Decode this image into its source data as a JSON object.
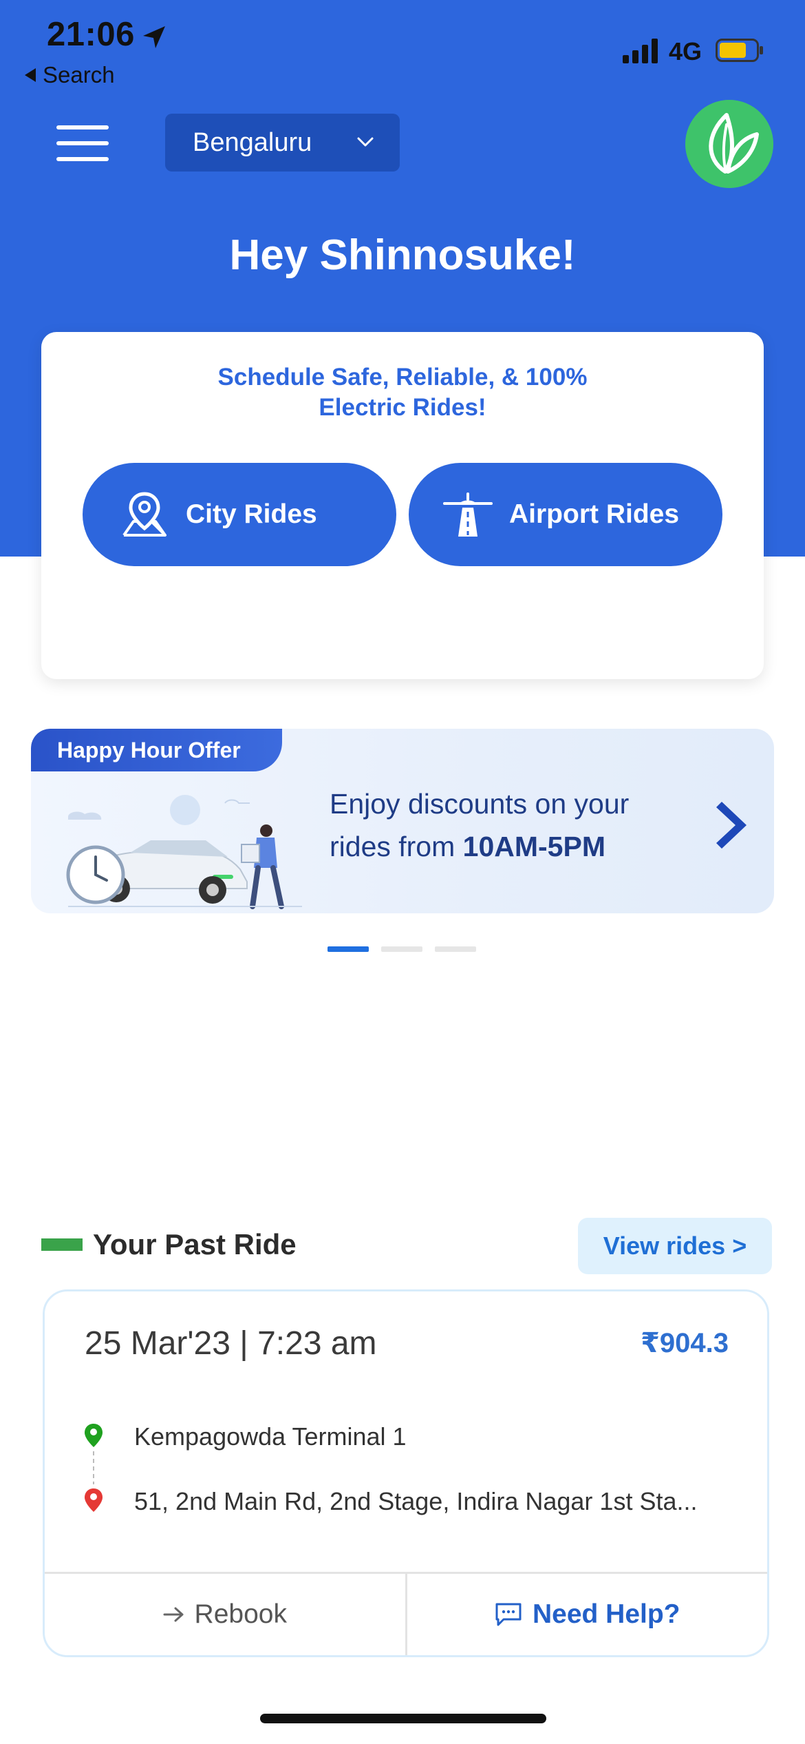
{
  "status_bar": {
    "time": "21:06",
    "back_label": "Search",
    "network": "4G",
    "battery_color": "#f5c400"
  },
  "header": {
    "city": "Bengaluru"
  },
  "greeting": "Hey Shinnosuke!",
  "booking_card": {
    "tagline_line1": "Schedule Safe, Reliable, & 100%",
    "tagline_line2": "Electric Rides!",
    "city_rides_label": "City Rides",
    "airport_rides_label": "Airport Rides"
  },
  "offer": {
    "badge": "Happy Hour Offer",
    "text_line1": "Enjoy discounts on your",
    "text_line2_prefix": "rides from ",
    "text_line2_bold": "10AM-5PM",
    "carousel_total": 3,
    "carousel_active": 1
  },
  "past_ride": {
    "section_title": "Your Past Ride",
    "view_rides_label": "View rides >",
    "date": "25 Mar'23 | 7:23 am",
    "price": "₹904.3",
    "pickup": "Kempagowda Terminal 1",
    "drop": "51, 2nd Main Rd, 2nd Stage, Indira Nagar 1st Sta...",
    "rebook_label": "Rebook",
    "help_label": "Need Help?"
  },
  "colors": {
    "primary": "#2d66dd",
    "brand_green": "#3ec36a",
    "accent_green": "#3aa34a",
    "pickup_pin": "#1fa11f",
    "drop_pin": "#e53935"
  }
}
